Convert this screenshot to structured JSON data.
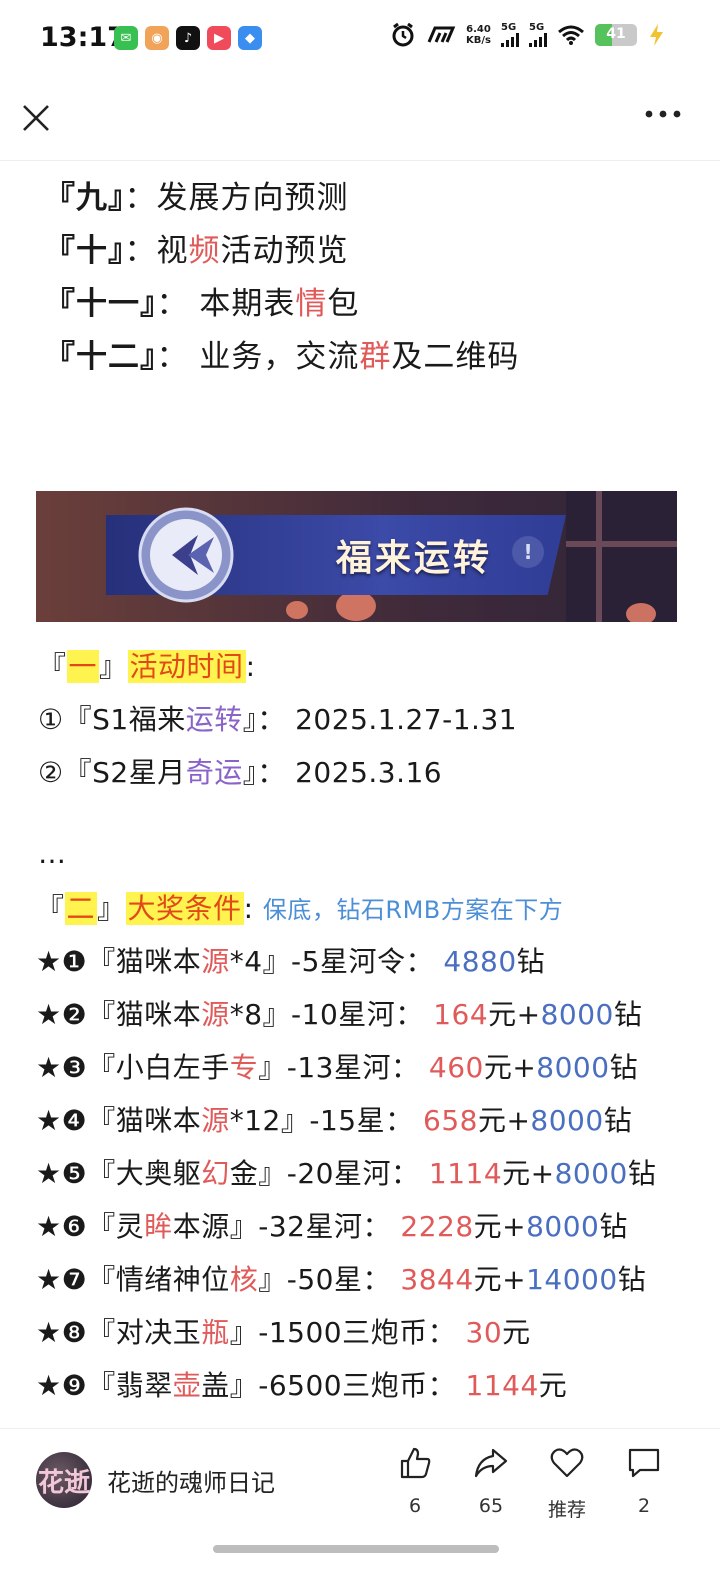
{
  "status_bar": {
    "time": "13:17",
    "net_speed_value": "6.40",
    "net_speed_unit": "KB/s",
    "signal1": "5G",
    "signal2": "5G",
    "battery": "41",
    "battery_level": 0.41
  },
  "toc": [
    {
      "num": "『九』",
      "sep": "：",
      "parts": [
        {
          "t": "发展方向预测",
          "c": ""
        }
      ]
    },
    {
      "num": "『十』",
      "sep": "：",
      "parts": [
        {
          "t": "视",
          "c": ""
        },
        {
          "t": "频",
          "c": "red"
        },
        {
          "t": "活动预览",
          "c": ""
        }
      ]
    },
    {
      "num": "『十一』",
      "sep": "： ",
      "parts": [
        {
          "t": "本期表",
          "c": ""
        },
        {
          "t": "情",
          "c": "red"
        },
        {
          "t": "包",
          "c": ""
        }
      ]
    },
    {
      "num": "『十二』",
      "sep": "： ",
      "parts": [
        {
          "t": "业务，交流",
          "c": ""
        },
        {
          "t": "群",
          "c": "red"
        },
        {
          "t": "及二维码",
          "c": ""
        }
      ]
    }
  ],
  "banner": {
    "title": "福来运转",
    "alert": "!"
  },
  "section1": {
    "open": "『",
    "num": "一",
    "close": "』",
    "title": "活动时间",
    "colon": ":",
    "items": [
      {
        "parts": [
          {
            "t": "①『S1福来",
            "c": ""
          },
          {
            "t": "运转",
            "c": "purple"
          },
          {
            "t": "』： 2025.1.27-1.31",
            "c": ""
          }
        ]
      },
      {
        "parts": [
          {
            "t": "②『S2星月",
            "c": ""
          },
          {
            "t": "奇运",
            "c": "purple"
          },
          {
            "t": "』： 2025.3.16",
            "c": ""
          }
        ]
      }
    ],
    "ellipsis": "…"
  },
  "section2": {
    "open": "『",
    "num": "二",
    "close": "』",
    "title": "大奖条件",
    "colon": ": ",
    "subtitle": "保底，钻石RMB方案在下方",
    "items": [
      {
        "parts": [
          {
            "t": "★❶『猫咪本",
            "c": ""
          },
          {
            "t": "源",
            "c": "red"
          },
          {
            "t": "*4』-5星河令： ",
            "c": ""
          },
          {
            "t": "4880",
            "c": "blue"
          },
          {
            "t": "钻",
            "c": ""
          }
        ]
      },
      {
        "parts": [
          {
            "t": "★❷『猫咪本",
            "c": ""
          },
          {
            "t": "源",
            "c": "red"
          },
          {
            "t": "*8』-10星河： ",
            "c": ""
          },
          {
            "t": "164",
            "c": "red"
          },
          {
            "t": "元+",
            "c": ""
          },
          {
            "t": "8000",
            "c": "blue"
          },
          {
            "t": "钻",
            "c": ""
          }
        ]
      },
      {
        "parts": [
          {
            "t": "★❸『小白左手",
            "c": ""
          },
          {
            "t": "专",
            "c": "red"
          },
          {
            "t": "』-13星河： ",
            "c": ""
          },
          {
            "t": "460",
            "c": "red"
          },
          {
            "t": "元+",
            "c": ""
          },
          {
            "t": "8000",
            "c": "blue"
          },
          {
            "t": "钻",
            "c": ""
          }
        ]
      },
      {
        "parts": [
          {
            "t": "★❹『猫咪本",
            "c": ""
          },
          {
            "t": "源",
            "c": "red"
          },
          {
            "t": "*12』-15星： ",
            "c": ""
          },
          {
            "t": "658",
            "c": "red"
          },
          {
            "t": "元+",
            "c": ""
          },
          {
            "t": "8000",
            "c": "blue"
          },
          {
            "t": "钻",
            "c": ""
          }
        ]
      },
      {
        "parts": [
          {
            "t": "★❺『大奥躯",
            "c": ""
          },
          {
            "t": "幻",
            "c": "red"
          },
          {
            "t": "金』-20星河： ",
            "c": ""
          },
          {
            "t": "1114",
            "c": "red"
          },
          {
            "t": "元+",
            "c": ""
          },
          {
            "t": "8000",
            "c": "blue"
          },
          {
            "t": "钻",
            "c": ""
          }
        ]
      },
      {
        "parts": [
          {
            "t": "★❻『灵",
            "c": ""
          },
          {
            "t": "眸",
            "c": "red"
          },
          {
            "t": "本源』-32星河： ",
            "c": ""
          },
          {
            "t": "2228",
            "c": "red"
          },
          {
            "t": "元+",
            "c": ""
          },
          {
            "t": "8000",
            "c": "blue"
          },
          {
            "t": "钻",
            "c": ""
          }
        ]
      },
      {
        "parts": [
          {
            "t": "★❼『情绪神位",
            "c": ""
          },
          {
            "t": "核",
            "c": "red"
          },
          {
            "t": "』-50星： ",
            "c": ""
          },
          {
            "t": "3844",
            "c": "red"
          },
          {
            "t": "元+",
            "c": ""
          },
          {
            "t": "14000",
            "c": "blue"
          },
          {
            "t": "钻",
            "c": ""
          }
        ]
      },
      {
        "parts": [
          {
            "t": "★❽『对决玉",
            "c": ""
          },
          {
            "t": "瓶",
            "c": "red"
          },
          {
            "t": "』-1500三炮币： ",
            "c": ""
          },
          {
            "t": "30",
            "c": "red"
          },
          {
            "t": "元",
            "c": ""
          }
        ]
      },
      {
        "parts": [
          {
            "t": "★❾『翡翠",
            "c": ""
          },
          {
            "t": "壶",
            "c": "red"
          },
          {
            "t": "盖』-6500三炮币： ",
            "c": ""
          },
          {
            "t": "1144",
            "c": "red"
          },
          {
            "t": "元",
            "c": ""
          }
        ]
      }
    ]
  },
  "bottom_bar": {
    "avatar_text": "花逝",
    "author": "花逝的魂师日记",
    "like_count": "6",
    "share_count": "65",
    "recommend_label": "推荐",
    "comment_count": "2"
  },
  "colors": {
    "red": "#e15a5a",
    "blue": "#4a6fc0",
    "purple": "#8a63c9",
    "highlight": "#fff44f"
  }
}
